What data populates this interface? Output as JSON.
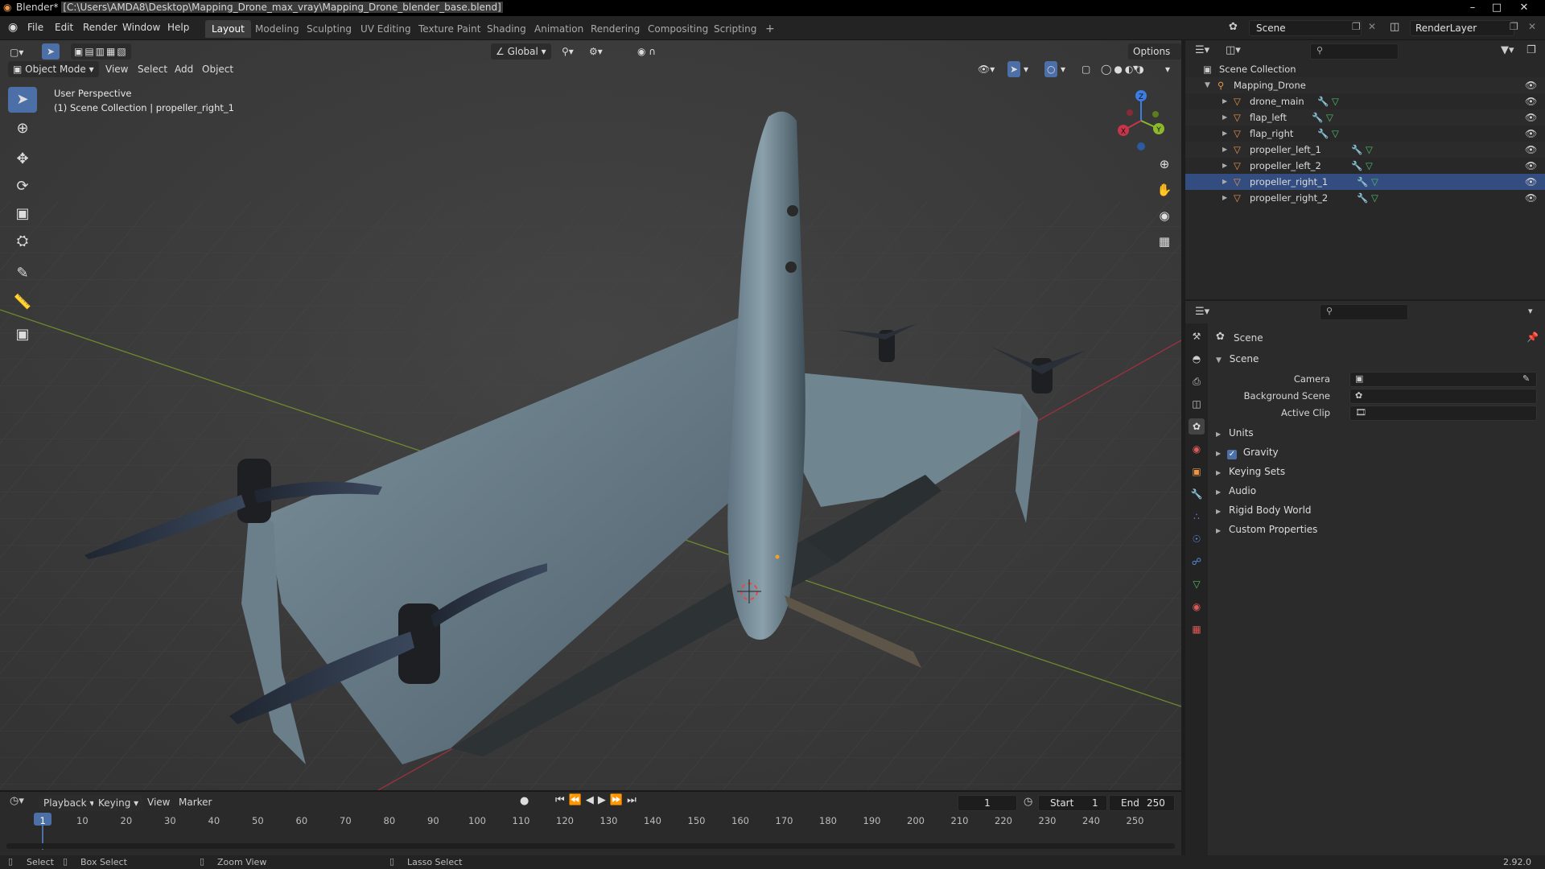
{
  "titlebar": {
    "app": "Blender*",
    "path": "[C:\\Users\\AMDA8\\Desktop\\Mapping_Drone_max_vray\\Mapping_Drone_blender_base.blend]",
    "minimize": "–",
    "maximize": "□",
    "close": "✕"
  },
  "menu": {
    "items": [
      "File",
      "Edit",
      "Render",
      "Window",
      "Help"
    ],
    "workspaces": [
      "Layout",
      "Modeling",
      "Sculpting",
      "UV Editing",
      "Texture Paint",
      "Shading",
      "Animation",
      "Rendering",
      "Compositing",
      "Scripting"
    ],
    "add_tab": "+",
    "scene": "Scene",
    "view_layer": "RenderLayer"
  },
  "viewport": {
    "transform_orientation": "Global",
    "options_label": "Options",
    "mode": "Object Mode",
    "header_menus": [
      "View",
      "Select",
      "Add",
      "Object"
    ],
    "overlay_title": "User Perspective",
    "overlay_context": "(1) Scene Collection | propeller_right_1",
    "gizmo_axes": {
      "x": "X",
      "y": "Y",
      "z": "Z"
    }
  },
  "outliner": {
    "root": "Scene Collection",
    "collection": "Mapping_Drone",
    "objects": [
      "drone_main",
      "flap_left",
      "flap_right",
      "propeller_left_1",
      "propeller_left_2",
      "propeller_right_1",
      "propeller_right_2"
    ],
    "selected": "propeller_right_1"
  },
  "properties": {
    "context": "Scene",
    "panel": "Scene",
    "fields": [
      {
        "label": "Camera"
      },
      {
        "label": "Background Scene"
      },
      {
        "label": "Active Clip"
      }
    ],
    "sections": [
      "Units",
      "Gravity",
      "Keying Sets",
      "Audio",
      "Rigid Body World",
      "Custom Properties"
    ],
    "gravity_enabled": true
  },
  "timeline": {
    "menus": [
      "Playback",
      "Keying",
      "View",
      "Marker"
    ],
    "current_frame": "1",
    "start_label": "Start",
    "start": "1",
    "end_label": "End",
    "end": "250",
    "ruler": [
      "1",
      "10",
      "20",
      "30",
      "40",
      "50",
      "60",
      "70",
      "80",
      "90",
      "100",
      "110",
      "120",
      "130",
      "140",
      "150",
      "160",
      "170",
      "180",
      "190",
      "200",
      "210",
      "220",
      "230",
      "240",
      "250"
    ]
  },
  "statusbar": {
    "items": [
      "Select",
      "Box Select",
      "Zoom View",
      "Lasso Select"
    ],
    "version": "2.92.0"
  },
  "colors": {
    "accent": "#4b6fa6",
    "x_axis": "#c8344a",
    "y_axis": "#8cb92b",
    "z_axis": "#3b7de0",
    "object_icon": "#e8964b"
  }
}
